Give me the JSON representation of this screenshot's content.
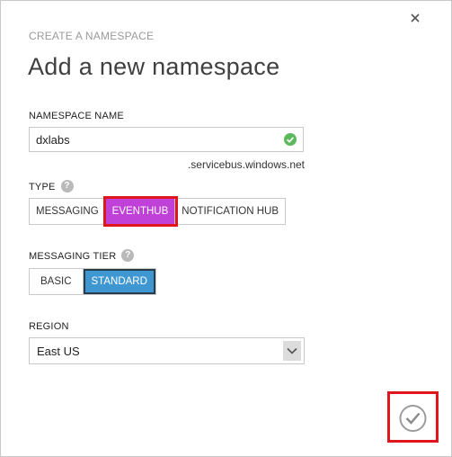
{
  "dialog": {
    "breadcrumb": "CREATE A NAMESPACE",
    "title": "Add a new namespace"
  },
  "namespace": {
    "label": "NAMESPACE NAME",
    "value": "dxlabs",
    "suffix": ".servicebus.windows.net",
    "status": "valid",
    "status_color": "#5cb85c"
  },
  "type": {
    "label": "TYPE",
    "help_icon": "?",
    "options": [
      "MESSAGING",
      "EVENTHUB",
      "NOTIFICATION HUB"
    ],
    "selected": "EVENTHUB",
    "selected_color": "#c041d8"
  },
  "tier": {
    "label": "MESSAGING TIER",
    "help_icon": "?",
    "options": [
      "BASIC",
      "STANDARD"
    ],
    "selected": "STANDARD",
    "selected_color": "#3e97d1"
  },
  "region": {
    "label": "REGION",
    "value": "East US"
  },
  "icons": {
    "close": "close-icon",
    "confirm": "checkmark-icon",
    "valid": "check-circle-icon",
    "help": "help-icon"
  },
  "highlight_color": "#e0161f"
}
